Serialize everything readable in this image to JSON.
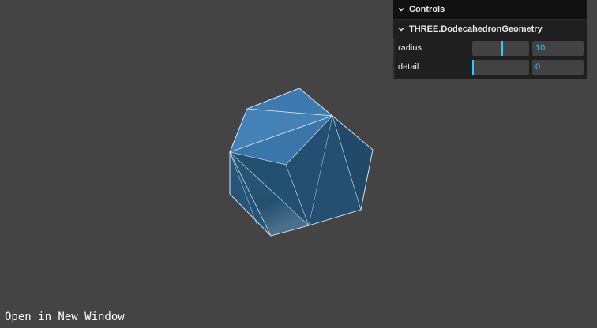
{
  "gui": {
    "title": "Controls",
    "folder": {
      "title": "THREE.DodecahedronGeometry",
      "controls": [
        {
          "label": "radius",
          "value": "10",
          "fraction": 0.47
        },
        {
          "label": "detail",
          "value": "0",
          "fraction": 0.0
        }
      ]
    }
  },
  "footer": {
    "link_label": "Open in New Window"
  },
  "colors": {
    "background": "#444444",
    "mesh_light": "#3f7cb1",
    "mesh_dark": "#234e6d",
    "wireframe": "#cfe3f2",
    "accent": "#2cc9ff"
  }
}
